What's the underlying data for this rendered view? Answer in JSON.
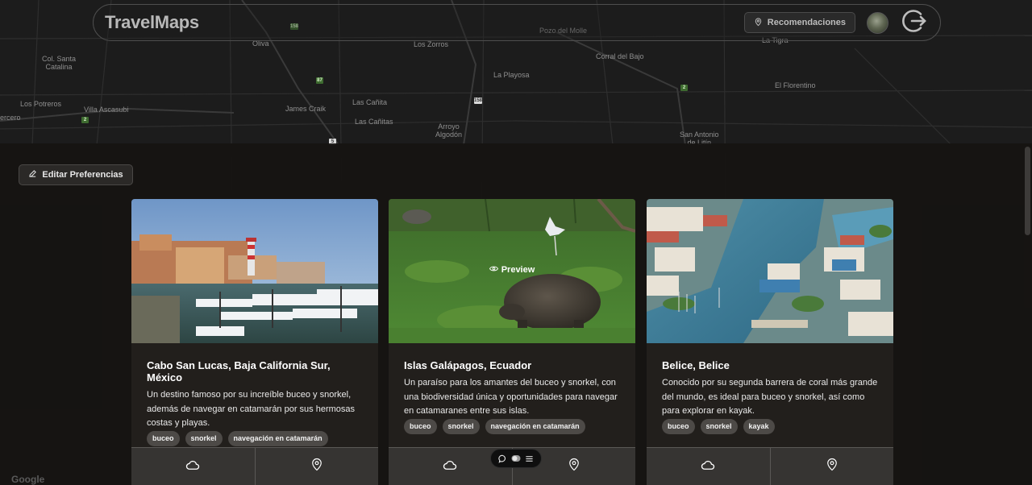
{
  "header": {
    "brand": "TravelMaps",
    "recommendations_label": "Recomendaciones"
  },
  "map": {
    "labels": [
      {
        "text": "Col. Santa\nCatalina"
      },
      {
        "text": "Los Potreros"
      },
      {
        "text": "Villa Ascasubi"
      },
      {
        "text": "ercero"
      },
      {
        "text": "Oliva"
      },
      {
        "text": "James Craik"
      },
      {
        "text": "Los Zorros"
      },
      {
        "text": "Las Cañita"
      },
      {
        "text": "Las Cañitas"
      },
      {
        "text": "La Playosa"
      },
      {
        "text": "Arroyo\nAlgodón"
      },
      {
        "text": "Pozo del Molle"
      },
      {
        "text": "Corral del Bajo"
      },
      {
        "text": "San Antonio\nde Litín"
      },
      {
        "text": "El Florentino"
      },
      {
        "text": "La Tigra"
      }
    ],
    "shields": [
      "2",
      "158",
      "87",
      "158",
      "5",
      "2",
      "158"
    ],
    "attribution": "Google"
  },
  "toolbar": {
    "edit_prefs_label": "Editar Preferencias"
  },
  "cards": [
    {
      "title": "Cabo San Lucas, Baja California Sur, México",
      "description": "Un destino famoso por su increíble buceo y snorkel, además de navegar en catamarán por sus hermosas costas y playas.",
      "tags": [
        "buceo",
        "snorkel",
        "navegación en catamarán"
      ]
    },
    {
      "title": "Islas Galápagos, Ecuador",
      "description": "Un paraíso para los amantes del buceo y snorkel, con una biodiversidad única y oportunidades para navegar en catamaranes entre sus islas.",
      "tags": [
        "buceo",
        "snorkel",
        "navegación en catamarán"
      ],
      "preview_label": "Preview"
    },
    {
      "title": "Belice, Belice",
      "description": "Conocido por su segunda barrera de coral más grande del mundo, es ideal para buceo y snorkel, así como para explorar en kayak.",
      "tags": [
        "buceo",
        "snorkel",
        "kayak"
      ]
    }
  ],
  "icons": {
    "weather": "cloud-icon",
    "location": "map-pin-icon",
    "logout": "logout-icon",
    "edit": "pencil-icon",
    "preview": "eye-icon"
  }
}
